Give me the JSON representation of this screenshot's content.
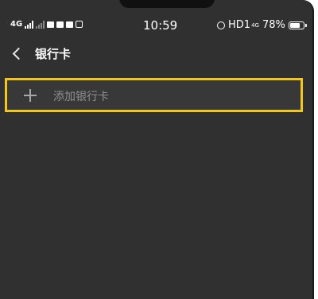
{
  "status_bar": {
    "network": "4G",
    "time": "10:59",
    "hd_label": "HD1",
    "hd_sup": "4G",
    "battery": "78%",
    "battery_level": 0.78
  },
  "header": {
    "title": "银行卡"
  },
  "add_card": {
    "label": "添加银行卡"
  },
  "colors": {
    "background": "#303030",
    "highlight": "#f3c61d"
  },
  "icons": [
    "back-icon",
    "plus-icon",
    "alarm-icon",
    "battery-icon",
    "signal-icon"
  ]
}
